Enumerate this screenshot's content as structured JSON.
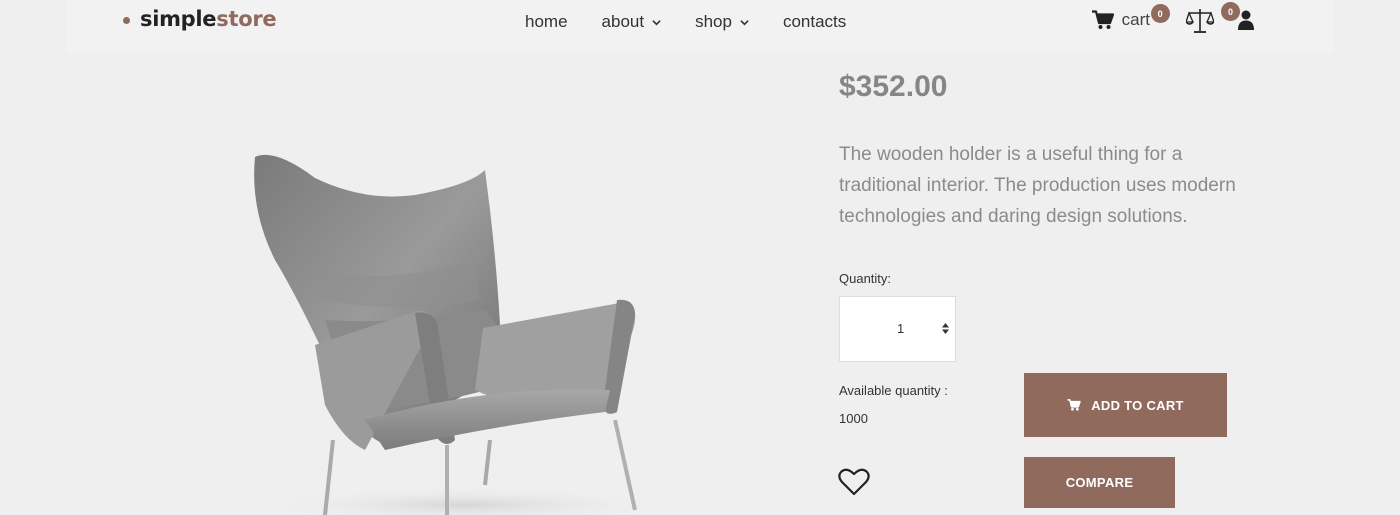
{
  "header": {
    "logo": {
      "part1": "simple",
      "part2": "store"
    },
    "nav": [
      {
        "label": "home",
        "dropdown": false
      },
      {
        "label": "about",
        "dropdown": true
      },
      {
        "label": "shop",
        "dropdown": true
      },
      {
        "label": "contacts",
        "dropdown": false
      }
    ],
    "cart": {
      "label": "cart",
      "count": "0"
    },
    "compare": {
      "count": "0"
    },
    "icons": {
      "cart": "shopping-cart-icon",
      "compare": "scales-icon",
      "user": "user-icon"
    }
  },
  "product": {
    "image": "armchair-image",
    "price": "$352.00",
    "description": "The wooden holder is a useful thing for a traditional interior. The production uses modern technologies and daring design solutions.",
    "quantity_label": "Quantity:",
    "quantity_value": "1",
    "available_label": "Available quantity :",
    "available_value": "1000",
    "add_to_cart": "ADD TO CART",
    "compare": "COMPARE",
    "wishlist_icon": "heart-icon"
  },
  "colors": {
    "accent": "#8f6a5d",
    "background": "#efefef",
    "header_bg": "#f2f2f2",
    "price": "#868686"
  }
}
